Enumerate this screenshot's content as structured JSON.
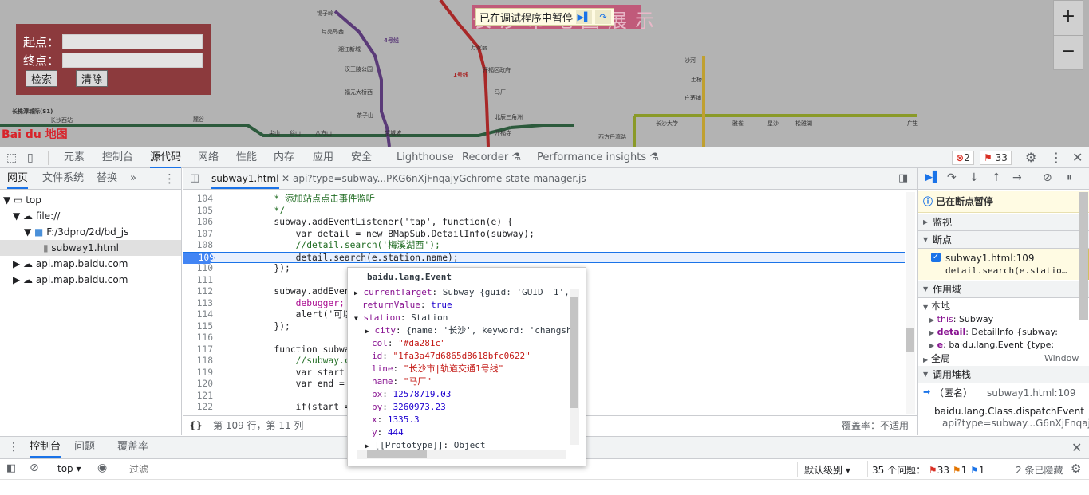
{
  "map": {
    "search": {
      "start_label": "起点：",
      "end_label": "终点：",
      "search_button": "检索",
      "clear_button": "清除"
    },
    "zoom": {
      "in": "+",
      "out": "−"
    },
    "logo": "Bai du 地图",
    "bg_title": "长沙市地图展示",
    "station_labels": [
      "锡子岭",
      "月亮岛西",
      "湘江新城",
      "汉王陵公园",
      "福元大桥西",
      "茶子山",
      "麓谷",
      "长沙西站",
      "尖山",
      "谷山",
      "八方山",
      "望城坡",
      "溁湾镇",
      "金溪",
      "火星",
      "长沙大学",
      "雅雀",
      "星沙",
      "松雅湖",
      "广生",
      "2号线",
      "4号线",
      "1号线",
      "马厂",
      "万家丽",
      "开福区政府",
      "北辰三角洲",
      "伍家岭",
      "开福寺",
      "沙河",
      "土桥",
      "白茅铺",
      "凤凰",
      "西方丹湾路",
      "长株潭城际(S1)"
    ],
    "line_labels": {
      "line1": "1号线",
      "line4": "4号线"
    },
    "paused_text": "已在调试程序中暂停"
  },
  "devtools": {
    "tabs": [
      "元素",
      "控制台",
      "源代码",
      "网络",
      "性能",
      "内存",
      "应用",
      "安全",
      "Lighthouse",
      "Recorder ⚗",
      "Performance insights ⚗"
    ],
    "active_tab": "源代码",
    "badges": {
      "errors": "2",
      "issues": "33"
    },
    "navigator": {
      "tabs": [
        "网页",
        "文件系统",
        "替换",
        "»"
      ],
      "tree": [
        {
          "label": "top",
          "level": 0
        },
        {
          "label": "file://",
          "level": 1
        },
        {
          "label": "F:/3dpro/2d/bd_js",
          "level": 2
        },
        {
          "label": "subway1.html",
          "level": 3
        },
        {
          "label": "api.map.baidu.com",
          "level": 1
        },
        {
          "label": "api.map.baidu.com",
          "level": 1
        }
      ]
    },
    "editor": {
      "tabs": [
        "subway1.html",
        "api?type=subway...PKG6nXjFnqajyG",
        "chrome-state-manager.js"
      ],
      "lines": [
        {
          "n": "104",
          "t": "        * 添加站点点击事件监听"
        },
        {
          "n": "105",
          "t": "        */"
        },
        {
          "n": "106",
          "t": "        subway.addEventListener('tap', function(e) {"
        },
        {
          "n": "107",
          "t": "            var detail = new BMapSub.DetailInfo(subway);"
        },
        {
          "n": "108",
          "t": "            //detail.search('梅溪湖西');"
        },
        {
          "n": "109",
          "t": "            detail.search(e.station.name);"
        },
        {
          "n": "110",
          "t": "        });"
        },
        {
          "n": "111",
          "t": ""
        },
        {
          "n": "112",
          "t": "        subway.addEventLi"
        },
        {
          "n": "113",
          "t": "            debugger;"
        },
        {
          "n": "114",
          "t": "            alert('可以自"
        },
        {
          "n": "115",
          "t": "        });"
        },
        {
          "n": "116",
          "t": ""
        },
        {
          "n": "117",
          "t": "        function subwayNa"
        },
        {
          "n": "118",
          "t": "            //subway.clea"
        },
        {
          "n": "119",
          "t": "            var start = c"
        },
        {
          "n": "120",
          "t": "            var end = doc"
        },
        {
          "n": "121",
          "t": ""
        },
        {
          "n": "122",
          "t": "            if(start == '"
        }
      ],
      "status": "第 109 行，第 11 列",
      "coverage": "覆盖率：不适用"
    },
    "debugger": {
      "paused_title": "已在断点暂停",
      "sections": [
        "监视",
        "断点",
        "作用域",
        "调用堆栈"
      ],
      "breakpoint": {
        "file": "subway1.html:109",
        "code": "detail.search(e.statio…"
      },
      "scope_local": "本地",
      "scope_items": [
        {
          "k": "this",
          "v": "Subway"
        },
        {
          "k": "detail",
          "v": "DetailInfo {subway:"
        },
        {
          "k": "e",
          "v": "baidu.lang.Event {type:"
        }
      ],
      "scope_global": "全局",
      "scope_global_val": "Window",
      "call_stack": [
        {
          "fn": "（匿名）",
          "loc": "subway1.html:109"
        },
        {
          "fn": "baidu.lang.Class.dispatchEvent",
          "loc": "api?type=subway...G6nXjFnqajy"
        }
      ]
    },
    "popover": {
      "title": "baidu.lang.Event",
      "rows": [
        {
          "k": "currentTarget",
          "v": "Subway {guid: 'GUID__1',"
        },
        {
          "k": "returnValue",
          "v": "true"
        },
        {
          "k": "station",
          "v": "Station"
        },
        {
          "k": "city",
          "v": "{name: '长沙', keyword: 'changsh"
        },
        {
          "k": "col",
          "v": "\"#da281c\""
        },
        {
          "k": "id",
          "v": "\"1fa3a47d6865d8618bfc0622\""
        },
        {
          "k": "line",
          "v": "\"长沙市|轨道交通1号线\""
        },
        {
          "k": "name",
          "v": "\"马厂\""
        },
        {
          "k": "px",
          "v": "12578719.03"
        },
        {
          "k": "py",
          "v": "3260973.23"
        },
        {
          "k": "x",
          "v": "1335.3"
        },
        {
          "k": "y",
          "v": "444"
        },
        {
          "k": "[[Prototype]]",
          "v": "Object"
        }
      ]
    },
    "drawer": {
      "tabs": [
        "控制台",
        "问题",
        "覆盖率"
      ],
      "context": "top",
      "filter_placeholder": "过滤",
      "level": "默认级别",
      "issues_label": "35 个问题：",
      "issue_counts": {
        "error": "33",
        "warn": "1",
        "info": "1"
      },
      "hidden": "2 条已隐藏"
    }
  }
}
